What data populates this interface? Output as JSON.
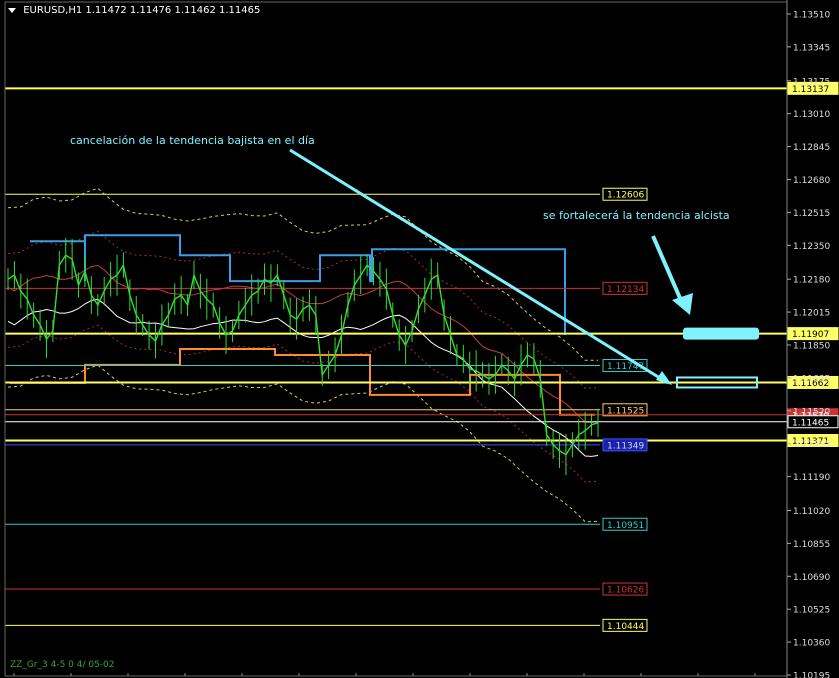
{
  "header": {
    "symbol": "EURUSD,H1",
    "ohlc": "1.11472 1.11476 1.11462 1.11465"
  },
  "annotations": {
    "left_note": "cancelación de la tendencia bajista en el día",
    "right_note": "se fortalecerá la tendencia alcista"
  },
  "footer": "ZZ_Gr_3 4-5 0 4/ 05-02",
  "chart_data": {
    "type": "line",
    "title": "EURUSD,H1",
    "ylim": [
      1.1019,
      1.1357
    ],
    "y_ticks": [
      "1.13510",
      "1.13345",
      "1.13175",
      "1.13010",
      "1.12845",
      "1.12680",
      "1.12515",
      "1.12350",
      "1.12180",
      "1.12015",
      "1.11850",
      "1.11685",
      "1.11520",
      "1.11355",
      "1.11190",
      "1.11020",
      "1.10855",
      "1.10690",
      "1.10525",
      "1.10360",
      "1.10195"
    ],
    "levels": [
      {
        "label": "1.13137",
        "value": 1.13137,
        "color": "#ffff66",
        "style": "axis"
      },
      {
        "label": "1.12606",
        "value": 1.12606,
        "color": "#ffff66",
        "style": "box"
      },
      {
        "label": "1.12134",
        "value": 1.12134,
        "color": "#cc3333",
        "style": "box"
      },
      {
        "label": "1.11907",
        "value": 1.11907,
        "color": "#ffff66",
        "style": "axis"
      },
      {
        "label": "1.11747",
        "value": 1.11747,
        "color": "#33cccc",
        "style": "box"
      },
      {
        "label": "1.11662",
        "value": 1.11662,
        "color": "#ffff66",
        "style": "axis"
      },
      {
        "label": "1.11525",
        "value": 1.11525,
        "color": "#ffcc66",
        "style": "box"
      },
      {
        "label": "1.11570",
        "value": 1.115,
        "color": "#cc3333",
        "style": "axisred"
      },
      {
        "label": "1.11465",
        "value": 1.11465,
        "color": "#ffffff",
        "style": "axiswhite"
      },
      {
        "label": "1.11371",
        "value": 1.11371,
        "color": "#ffff66",
        "style": "axis"
      },
      {
        "label": "1.11349",
        "value": 1.11349,
        "color": "#3355ff",
        "style": "boxblue"
      },
      {
        "label": "1.10951",
        "value": 1.10951,
        "color": "#33cccc",
        "style": "box"
      },
      {
        "label": "1.10626",
        "value": 1.10626,
        "color": "#cc3333",
        "style": "box"
      },
      {
        "label": "1.10444",
        "value": 1.10444,
        "color": "#ffff66",
        "style": "box"
      }
    ],
    "price_series": [
      1.1218,
      1.122,
      1.1212,
      1.1208,
      1.12,
      1.1195,
      1.1188,
      1.1192,
      1.1225,
      1.123,
      1.1228,
      1.1215,
      1.1222,
      1.121,
      1.1205,
      1.1212,
      1.1218,
      1.122,
      1.1225,
      1.121,
      1.12,
      1.1195,
      1.119,
      1.1187,
      1.1195,
      1.12,
      1.1208,
      1.121,
      1.1205,
      1.122,
      1.1212,
      1.1208,
      1.1205,
      1.1196,
      1.119,
      1.1192,
      1.12,
      1.1205,
      1.121,
      1.1212,
      1.1218,
      1.1216,
      1.122,
      1.121,
      1.12,
      1.1198,
      1.1203,
      1.1205,
      1.12,
      1.117,
      1.1175,
      1.118,
      1.119,
      1.1205,
      1.1215,
      1.122,
      1.1225,
      1.1222,
      1.1218,
      1.1213,
      1.12,
      1.119,
      1.1185,
      1.1192,
      1.1203,
      1.121,
      1.1218,
      1.122,
      1.12,
      1.119,
      1.118,
      1.1178,
      1.1173,
      1.1172,
      1.117,
      1.1168,
      1.117,
      1.1175,
      1.1172,
      1.1168,
      1.1175,
      1.118,
      1.1178,
      1.1168,
      1.114,
      1.1135,
      1.1132,
      1.113,
      1.1135,
      1.114,
      1.1142,
      1.1145,
      1.1146
    ]
  }
}
